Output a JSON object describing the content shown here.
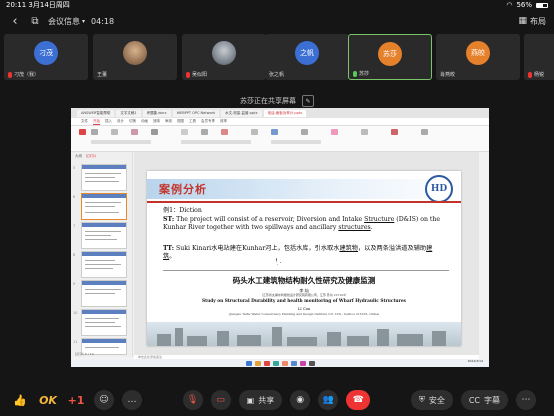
{
  "status": {
    "time": "20:11",
    "date": "3月14日周四",
    "battery": "56%"
  },
  "header": {
    "title": "会议信息",
    "duration": "04:18",
    "layout_label": "布局"
  },
  "participants": [
    {
      "initials": "刁茂",
      "name": "刁茂（我）",
      "color": "#3b6fd4",
      "muted": true
    },
    {
      "initials": "",
      "name": "王董",
      "color": "#8a6a4a",
      "muted": false,
      "photo": true
    },
    {
      "initials": "",
      "name": "吴似阳",
      "color": "#6a7a8a",
      "muted": true,
      "photo": true
    },
    {
      "initials": "之帆",
      "name": "张之帆",
      "color": "#3b6fd4",
      "muted": false
    },
    {
      "initials": "苏莎",
      "name": "苏莎",
      "color": "#e5802b",
      "muted": false,
      "active": true
    },
    {
      "initials": "燕皎",
      "name": "肖燕皎",
      "color": "#e5802b",
      "muted": false
    },
    {
      "initials": "",
      "name": "杨锐",
      "color": "#333",
      "muted": true
    }
  ],
  "share": {
    "banner": "苏莎正在共享屏幕"
  },
  "remote": {
    "tabs": [
      "ANSWER智能帮助",
      "文字文稿1",
      "考题集.docx",
      "WEBPPT OPC Network",
      "水文.测量-监管.pptx",
      "电话-面板功率计.pptx"
    ],
    "menu": [
      "文件",
      "开始",
      "插入",
      "设计",
      "切换",
      "动画",
      "放映",
      "审阅",
      "视图",
      "工具",
      "会员专享",
      "效率"
    ],
    "panel_tabs": [
      "大纲",
      "幻灯片"
    ],
    "slide_numbers": [
      "5",
      "6",
      "7",
      "8",
      "9",
      "10",
      "11",
      "12"
    ],
    "status_text": "幻灯片 6 / 19",
    "notes_text": "单击此处添加备注",
    "clock": "2024/3/14"
  },
  "slide": {
    "title": "案例分析",
    "logo": "HD",
    "example_label": "例1：Diction",
    "st_label": "ST:",
    "st_pre": "The project will consist of a reservoir, Diversion and Intake ",
    "st_u1": "Structure",
    "st_mid": " (D&IS) on the Kunhar River together with two spillways and ancillary ",
    "st_u2": "structures",
    "st_end": ".",
    "tt_label": "TT:",
    "tt_pre": "Suki Kinari水电站建在Kunhar河上，包括水库，引水取水",
    "tt_u1": "建筑物",
    "tt_mid": "，以及两条溢洪道及辅助",
    "tt_u2": "建筑",
    "tt_end": "。",
    "cn_title": "码头水工建筑物结构耐久性研究及健康监测",
    "cn_author": "李 灿",
    "cn_aff": "（江苏省太湖水利规划设计研究院有限公司，江苏 苏州 215103）",
    "en_title": "Study on Structural Durability and health monitoring of Wharf Hydraulic Structures",
    "en_author": "LI Can",
    "en_aff": "(Jiangsu Taihu Water Conservancy Planning and Design Institute CO. LTD., Suzhou 215103, China)"
  },
  "toolbar": {
    "ok": "OK",
    "plus_one": "+1",
    "share_label": "共享",
    "security_label": "安全",
    "captions_label": "字幕"
  }
}
